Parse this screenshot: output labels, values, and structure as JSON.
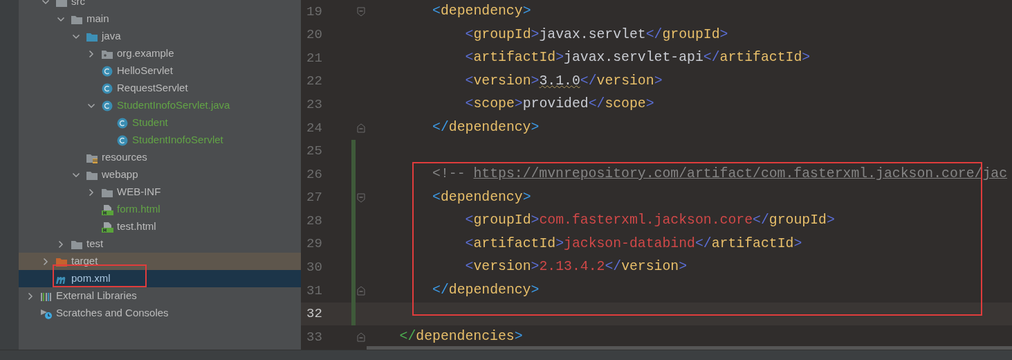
{
  "project_tree": {
    "project_children": [
      {
        "label": "src",
        "kind": "folder",
        "expanded": true,
        "selected": false,
        "added": false,
        "excluded": false,
        "highlighted": false,
        "children": [
          {
            "label": "main",
            "kind": "folder",
            "expanded": true,
            "selected": false,
            "added": false,
            "excluded": false,
            "highlighted": false,
            "children": [
              {
                "label": "java",
                "kind": "source-folder",
                "expanded": true,
                "selected": false,
                "added": false,
                "excluded": false,
                "highlighted": false,
                "children": [
                  {
                    "label": "org.example",
                    "kind": "package",
                    "expanded": false,
                    "selected": false,
                    "added": false,
                    "excluded": false,
                    "highlighted": false
                  },
                  {
                    "label": "HelloServlet",
                    "kind": "class",
                    "selected": false,
                    "added": false,
                    "excluded": false,
                    "highlighted": false
                  },
                  {
                    "label": "RequestServlet",
                    "kind": "class",
                    "selected": false,
                    "added": false,
                    "excluded": false,
                    "highlighted": false
                  },
                  {
                    "label": "StudentInofoServlet.java",
                    "kind": "class",
                    "expanded": true,
                    "selected": false,
                    "added": true,
                    "excluded": false,
                    "highlighted": false,
                    "children": [
                      {
                        "label": "Student",
                        "kind": "class",
                        "selected": false,
                        "added": true,
                        "excluded": false,
                        "highlighted": false
                      },
                      {
                        "label": "StudentInofoServlet",
                        "kind": "class",
                        "selected": false,
                        "added": true,
                        "excluded": false,
                        "highlighted": false
                      }
                    ]
                  }
                ]
              },
              {
                "label": "resources",
                "kind": "resources-folder",
                "selected": false,
                "added": false,
                "excluded": false,
                "highlighted": false
              },
              {
                "label": "webapp",
                "kind": "folder",
                "expanded": true,
                "selected": false,
                "added": false,
                "excluded": false,
                "highlighted": false,
                "children": [
                  {
                    "label": "WEB-INF",
                    "kind": "folder",
                    "expanded": false,
                    "selected": false,
                    "added": false,
                    "excluded": false,
                    "highlighted": false
                  },
                  {
                    "label": "form.html",
                    "kind": "html",
                    "selected": false,
                    "added": true,
                    "excluded": false,
                    "highlighted": false
                  },
                  {
                    "label": "test.html",
                    "kind": "html",
                    "selected": false,
                    "added": false,
                    "excluded": false,
                    "highlighted": false
                  }
                ]
              }
            ]
          },
          {
            "label": "test",
            "kind": "folder",
            "expanded": false,
            "selected": false,
            "added": false,
            "excluded": false,
            "highlighted": false
          }
        ]
      },
      {
        "label": "target",
        "kind": "excluded-folder",
        "expanded": false,
        "selected": false,
        "added": false,
        "excluded": true,
        "highlighted": false
      },
      {
        "label": "pom.xml",
        "kind": "maven",
        "selected": true,
        "added": false,
        "excluded": false,
        "highlighted": true
      }
    ],
    "root_items": [
      {
        "label": "External Libraries",
        "kind": "libraries",
        "expanded": false,
        "selected": false,
        "added": false,
        "excluded": false,
        "highlighted": false
      },
      {
        "label": "Scratches and Consoles",
        "kind": "scratches",
        "selected": false,
        "added": false,
        "excluded": false,
        "highlighted": false
      }
    ]
  },
  "editor": {
    "sections": [
      {
        "highlighted": false,
        "lines": [
          {
            "number": "19",
            "kind": "level2",
            "fold_open": true,
            "fold_close": false,
            "changed": false,
            "current": false,
            "tokens": [
              {
                "kind": "outer-bracket",
                "text": "<"
              },
              {
                "kind": "tag",
                "text": "dependency"
              },
              {
                "kind": "outer-bracket",
                "text": ">"
              }
            ]
          },
          {
            "number": "20",
            "kind": "level3",
            "fold_open": false,
            "fold_close": false,
            "changed": false,
            "current": false,
            "tokens": [
              {
                "kind": "bracket",
                "text": "<"
              },
              {
                "kind": "tag",
                "text": "groupId"
              },
              {
                "kind": "bracket",
                "text": ">"
              },
              {
                "kind": "text",
                "text": "javax.servlet"
              },
              {
                "kind": "bracket",
                "text": "</"
              },
              {
                "kind": "tag",
                "text": "groupId"
              },
              {
                "kind": "bracket",
                "text": ">"
              }
            ]
          },
          {
            "number": "21",
            "kind": "level3",
            "fold_open": false,
            "fold_close": false,
            "changed": false,
            "current": false,
            "tokens": [
              {
                "kind": "bracket",
                "text": "<"
              },
              {
                "kind": "tag",
                "text": "artifactId"
              },
              {
                "kind": "bracket",
                "text": ">"
              },
              {
                "kind": "text",
                "text": "javax.servlet-api"
              },
              {
                "kind": "bracket",
                "text": "</"
              },
              {
                "kind": "tag",
                "text": "artifactId"
              },
              {
                "kind": "bracket",
                "text": ">"
              }
            ]
          },
          {
            "number": "22",
            "kind": "level3",
            "fold_open": false,
            "fold_close": false,
            "changed": false,
            "current": false,
            "tokens": [
              {
                "kind": "bracket",
                "text": "<"
              },
              {
                "kind": "tag",
                "text": "version"
              },
              {
                "kind": "bracket",
                "text": ">"
              },
              {
                "kind": "warn-text",
                "text": "3.1.0"
              },
              {
                "kind": "bracket",
                "text": "</"
              },
              {
                "kind": "tag",
                "text": "version"
              },
              {
                "kind": "bracket",
                "text": ">"
              }
            ]
          },
          {
            "number": "23",
            "kind": "level3",
            "fold_open": false,
            "fold_close": false,
            "changed": false,
            "current": false,
            "tokens": [
              {
                "kind": "bracket",
                "text": "<"
              },
              {
                "kind": "tag",
                "text": "scope"
              },
              {
                "kind": "bracket",
                "text": ">"
              },
              {
                "kind": "text",
                "text": "provided"
              },
              {
                "kind": "bracket",
                "text": "</"
              },
              {
                "kind": "tag",
                "text": "scope"
              },
              {
                "kind": "bracket",
                "text": ">"
              }
            ]
          },
          {
            "number": "24",
            "kind": "level2",
            "fold_open": false,
            "fold_close": true,
            "changed": false,
            "current": false,
            "tokens": [
              {
                "kind": "outer-bracket",
                "text": "</"
              },
              {
                "kind": "tag",
                "text": "dependency"
              },
              {
                "kind": "outer-bracket",
                "text": ">"
              }
            ]
          },
          {
            "number": "25",
            "kind": "blank",
            "fold_open": false,
            "fold_close": false,
            "changed": true,
            "current": false
          }
        ]
      },
      {
        "highlighted": true,
        "lines": [
          {
            "number": "26",
            "kind": "level2",
            "fold_open": false,
            "fold_close": false,
            "changed": true,
            "current": false,
            "tokens": [
              {
                "kind": "comment",
                "text": "<!--"
              },
              {
                "kind": "link",
                "text": "https://mvnrepository.com/artifact/com.fasterxml.jackson.core/jac"
              }
            ]
          },
          {
            "number": "27",
            "kind": "level2",
            "fold_open": true,
            "fold_close": false,
            "changed": true,
            "current": false,
            "tokens": [
              {
                "kind": "outer-bracket",
                "text": "<"
              },
              {
                "kind": "tag",
                "text": "dependency"
              },
              {
                "kind": "outer-bracket",
                "text": ">"
              }
            ]
          },
          {
            "number": "28",
            "kind": "level3",
            "fold_open": false,
            "fold_close": false,
            "changed": true,
            "current": false,
            "tokens": [
              {
                "kind": "bracket",
                "text": "<"
              },
              {
                "kind": "tag",
                "text": "groupId"
              },
              {
                "kind": "bracket",
                "text": ">"
              },
              {
                "kind": "error-text",
                "text": "com.fasterxml.jackson.core"
              },
              {
                "kind": "bracket",
                "text": "</"
              },
              {
                "kind": "tag",
                "text": "groupId"
              },
              {
                "kind": "bracket",
                "text": ">"
              }
            ]
          },
          {
            "number": "29",
            "kind": "level3",
            "fold_open": false,
            "fold_close": false,
            "changed": true,
            "current": false,
            "tokens": [
              {
                "kind": "bracket",
                "text": "<"
              },
              {
                "kind": "tag",
                "text": "artifactId"
              },
              {
                "kind": "bracket",
                "text": ">"
              },
              {
                "kind": "error-text",
                "text": "jackson-databind"
              },
              {
                "kind": "bracket",
                "text": "</"
              },
              {
                "kind": "tag",
                "text": "artifactId"
              },
              {
                "kind": "bracket",
                "text": ">"
              }
            ]
          },
          {
            "number": "30",
            "kind": "level3",
            "fold_open": false,
            "fold_close": false,
            "changed": true,
            "current": false,
            "tokens": [
              {
                "kind": "bracket",
                "text": "<"
              },
              {
                "kind": "tag",
                "text": "version"
              },
              {
                "kind": "bracket",
                "text": ">"
              },
              {
                "kind": "error-text",
                "text": "2.13.4.2"
              },
              {
                "kind": "bracket",
                "text": "</"
              },
              {
                "kind": "tag",
                "text": "version"
              },
              {
                "kind": "bracket",
                "text": ">"
              }
            ]
          },
          {
            "number": "31",
            "kind": "level2",
            "fold_open": false,
            "fold_close": true,
            "changed": true,
            "current": false,
            "tokens": [
              {
                "kind": "outer-bracket",
                "text": "</"
              },
              {
                "kind": "tag",
                "text": "dependency"
              },
              {
                "kind": "outer-bracket",
                "text": ">"
              }
            ]
          },
          {
            "number": "32",
            "kind": "blank",
            "fold_open": false,
            "fold_close": false,
            "changed": true,
            "current": true
          }
        ]
      },
      {
        "highlighted": false,
        "lines": [
          {
            "number": "33",
            "kind": "level1",
            "fold_open": false,
            "fold_close": true,
            "changed": false,
            "current": false,
            "tokens": [
              {
                "kind": "green-bracket",
                "text": "</"
              },
              {
                "kind": "tag",
                "text": "dependencies"
              },
              {
                "kind": "outer-bracket",
                "text": ">"
              }
            ]
          }
        ]
      }
    ]
  }
}
